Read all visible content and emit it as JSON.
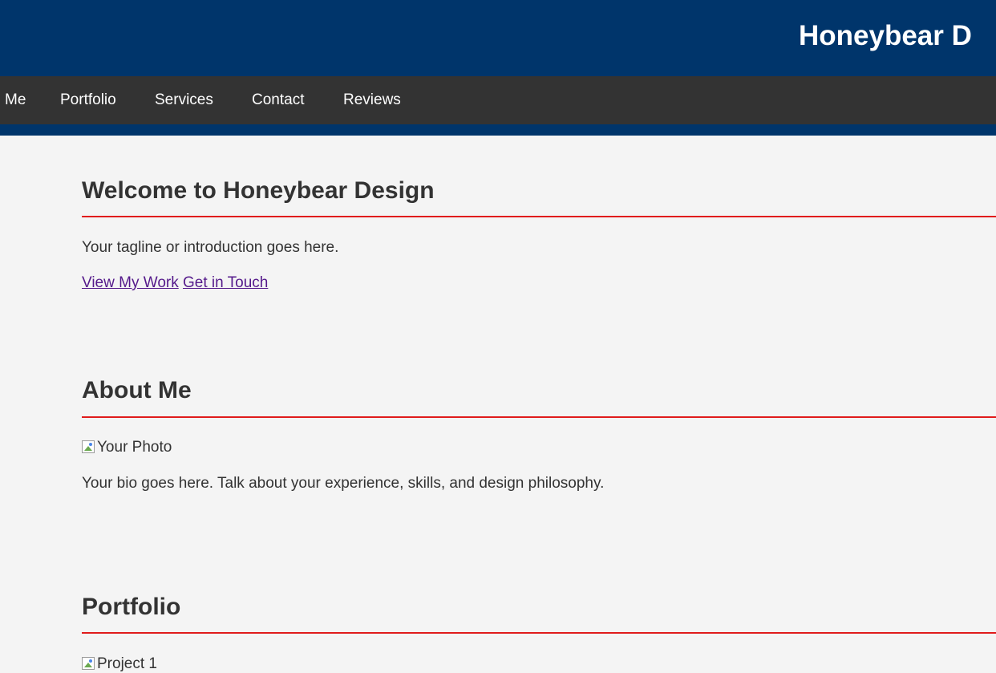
{
  "header": {
    "site_title": "Honeybear D"
  },
  "nav": {
    "items": [
      {
        "label": "Me"
      },
      {
        "label": "Portfolio"
      },
      {
        "label": "Services"
      },
      {
        "label": "Contact"
      },
      {
        "label": "Reviews"
      }
    ]
  },
  "hero": {
    "title": "Welcome to Honeybear Design",
    "tagline": "Your tagline or introduction goes here.",
    "cta_primary": "View My Work",
    "cta_secondary": "Get in Touch"
  },
  "about": {
    "title": "About Me",
    "photo_alt": "Your Photo",
    "bio": "Your bio goes here. Talk about your experience, skills, and design philosophy."
  },
  "portfolio": {
    "title": "Portfolio",
    "project_1_alt": "Project 1"
  },
  "colors": {
    "header_bg": "#00356b",
    "nav_bg": "#333333",
    "page_bg": "#f4f4f4",
    "rule": "#e01b1b",
    "link": "#551a8b"
  }
}
